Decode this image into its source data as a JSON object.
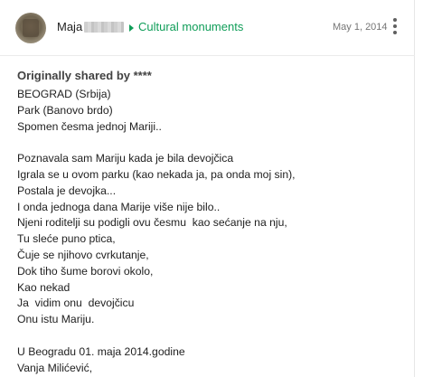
{
  "post": {
    "author": "Maja",
    "community": "Cultural monuments",
    "date": "May 1, 2014",
    "shared_by": "Originally shared by ****",
    "lines": [
      "BEOGRAD (Srbija)",
      "Park (Banovo brdo)",
      "Spomen česma jednoj Mariji..",
      "",
      "Poznavala sam Mariju kada je bila devojčica",
      "Igrala se u ovom parku (kao nekada ja, pa onda moj sin),",
      "Postala je devojka...",
      "I onda jednoga dana Marije više nije bilo..",
      "Njeni roditelji su podigli ovu česmu  kao sećanje na nju,",
      "Tu sleće puno ptica,",
      "Čuje se njihovo cvrkutanje,",
      "Dok tiho šume borovi okolo,",
      "Kao nekad",
      "Ja  vidim onu  devojčicu",
      "Onu istu Mariju.",
      "",
      "U Beogradu 01. maja 2014.godine",
      "Vanja Milićević,"
    ]
  },
  "icons": {
    "avatar": "profile-photo",
    "arrow": "triangle-right-icon",
    "menu": "more-vert-icon"
  },
  "colors": {
    "community": "#0f9d58",
    "date": "#757575",
    "text": "#212121"
  }
}
